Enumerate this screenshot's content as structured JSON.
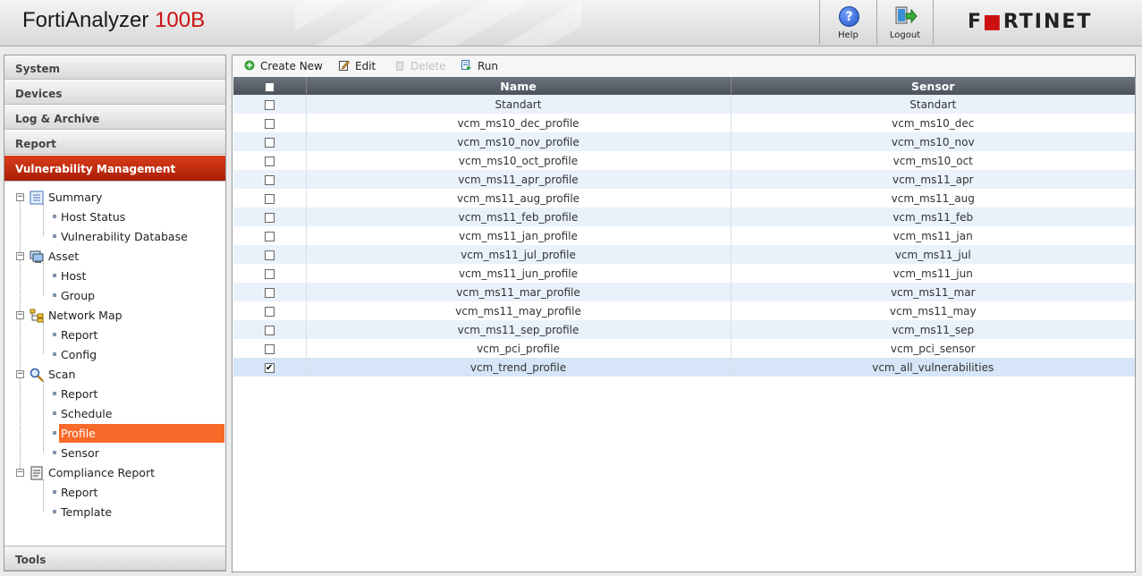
{
  "app": {
    "name": "FortiAnalyzer",
    "model": "100B"
  },
  "header": {
    "help_label": "Help",
    "logout_label": "Logout",
    "logo": "FORTINET"
  },
  "sidebar": {
    "sections": [
      "System",
      "Devices",
      "Log & Archive",
      "Report",
      "Vulnerability Management"
    ],
    "active_section": "Vulnerability Management",
    "tools_label": "Tools",
    "tree": {
      "summary": {
        "label": "Summary",
        "children": [
          "Host Status",
          "Vulnerability Database"
        ]
      },
      "asset": {
        "label": "Asset",
        "children": [
          "Host",
          "Group"
        ]
      },
      "network_map": {
        "label": "Network Map",
        "children": [
          "Report",
          "Config"
        ]
      },
      "scan": {
        "label": "Scan",
        "children": [
          "Report",
          "Schedule",
          "Profile",
          "Sensor"
        ],
        "selected": "Profile"
      },
      "compliance": {
        "label": "Compliance Report",
        "children": [
          "Report",
          "Template"
        ]
      }
    }
  },
  "toolbar": {
    "create_new": "Create New",
    "edit": "Edit",
    "delete": "Delete",
    "run": "Run"
  },
  "table": {
    "columns": [
      "Name",
      "Sensor"
    ],
    "rows": [
      {
        "name": "Standart",
        "sensor": "Standart",
        "checked": false
      },
      {
        "name": "vcm_ms10_dec_profile",
        "sensor": "vcm_ms10_dec",
        "checked": false
      },
      {
        "name": "vcm_ms10_nov_profile",
        "sensor": "vcm_ms10_nov",
        "checked": false
      },
      {
        "name": "vcm_ms10_oct_profile",
        "sensor": "vcm_ms10_oct",
        "checked": false
      },
      {
        "name": "vcm_ms11_apr_profile",
        "sensor": "vcm_ms11_apr",
        "checked": false
      },
      {
        "name": "vcm_ms11_aug_profile",
        "sensor": "vcm_ms11_aug",
        "checked": false
      },
      {
        "name": "vcm_ms11_feb_profile",
        "sensor": "vcm_ms11_feb",
        "checked": false
      },
      {
        "name": "vcm_ms11_jan_profile",
        "sensor": "vcm_ms11_jan",
        "checked": false
      },
      {
        "name": "vcm_ms11_jul_profile",
        "sensor": "vcm_ms11_jul",
        "checked": false
      },
      {
        "name": "vcm_ms11_jun_profile",
        "sensor": "vcm_ms11_jun",
        "checked": false
      },
      {
        "name": "vcm_ms11_mar_profile",
        "sensor": "vcm_ms11_mar",
        "checked": false
      },
      {
        "name": "vcm_ms11_may_profile",
        "sensor": "vcm_ms11_may",
        "checked": false
      },
      {
        "name": "vcm_ms11_sep_profile",
        "sensor": "vcm_ms11_sep",
        "checked": false
      },
      {
        "name": "vcm_pci_profile",
        "sensor": "vcm_pci_sensor",
        "checked": false
      },
      {
        "name": "vcm_trend_profile",
        "sensor": "vcm_all_vulnerabilities",
        "checked": true
      }
    ]
  },
  "colors": {
    "brand_red": "#cc1111",
    "active_nav": "#b8260c",
    "selected_tree": "#f86a2a",
    "grid_header": "#5a6068"
  }
}
